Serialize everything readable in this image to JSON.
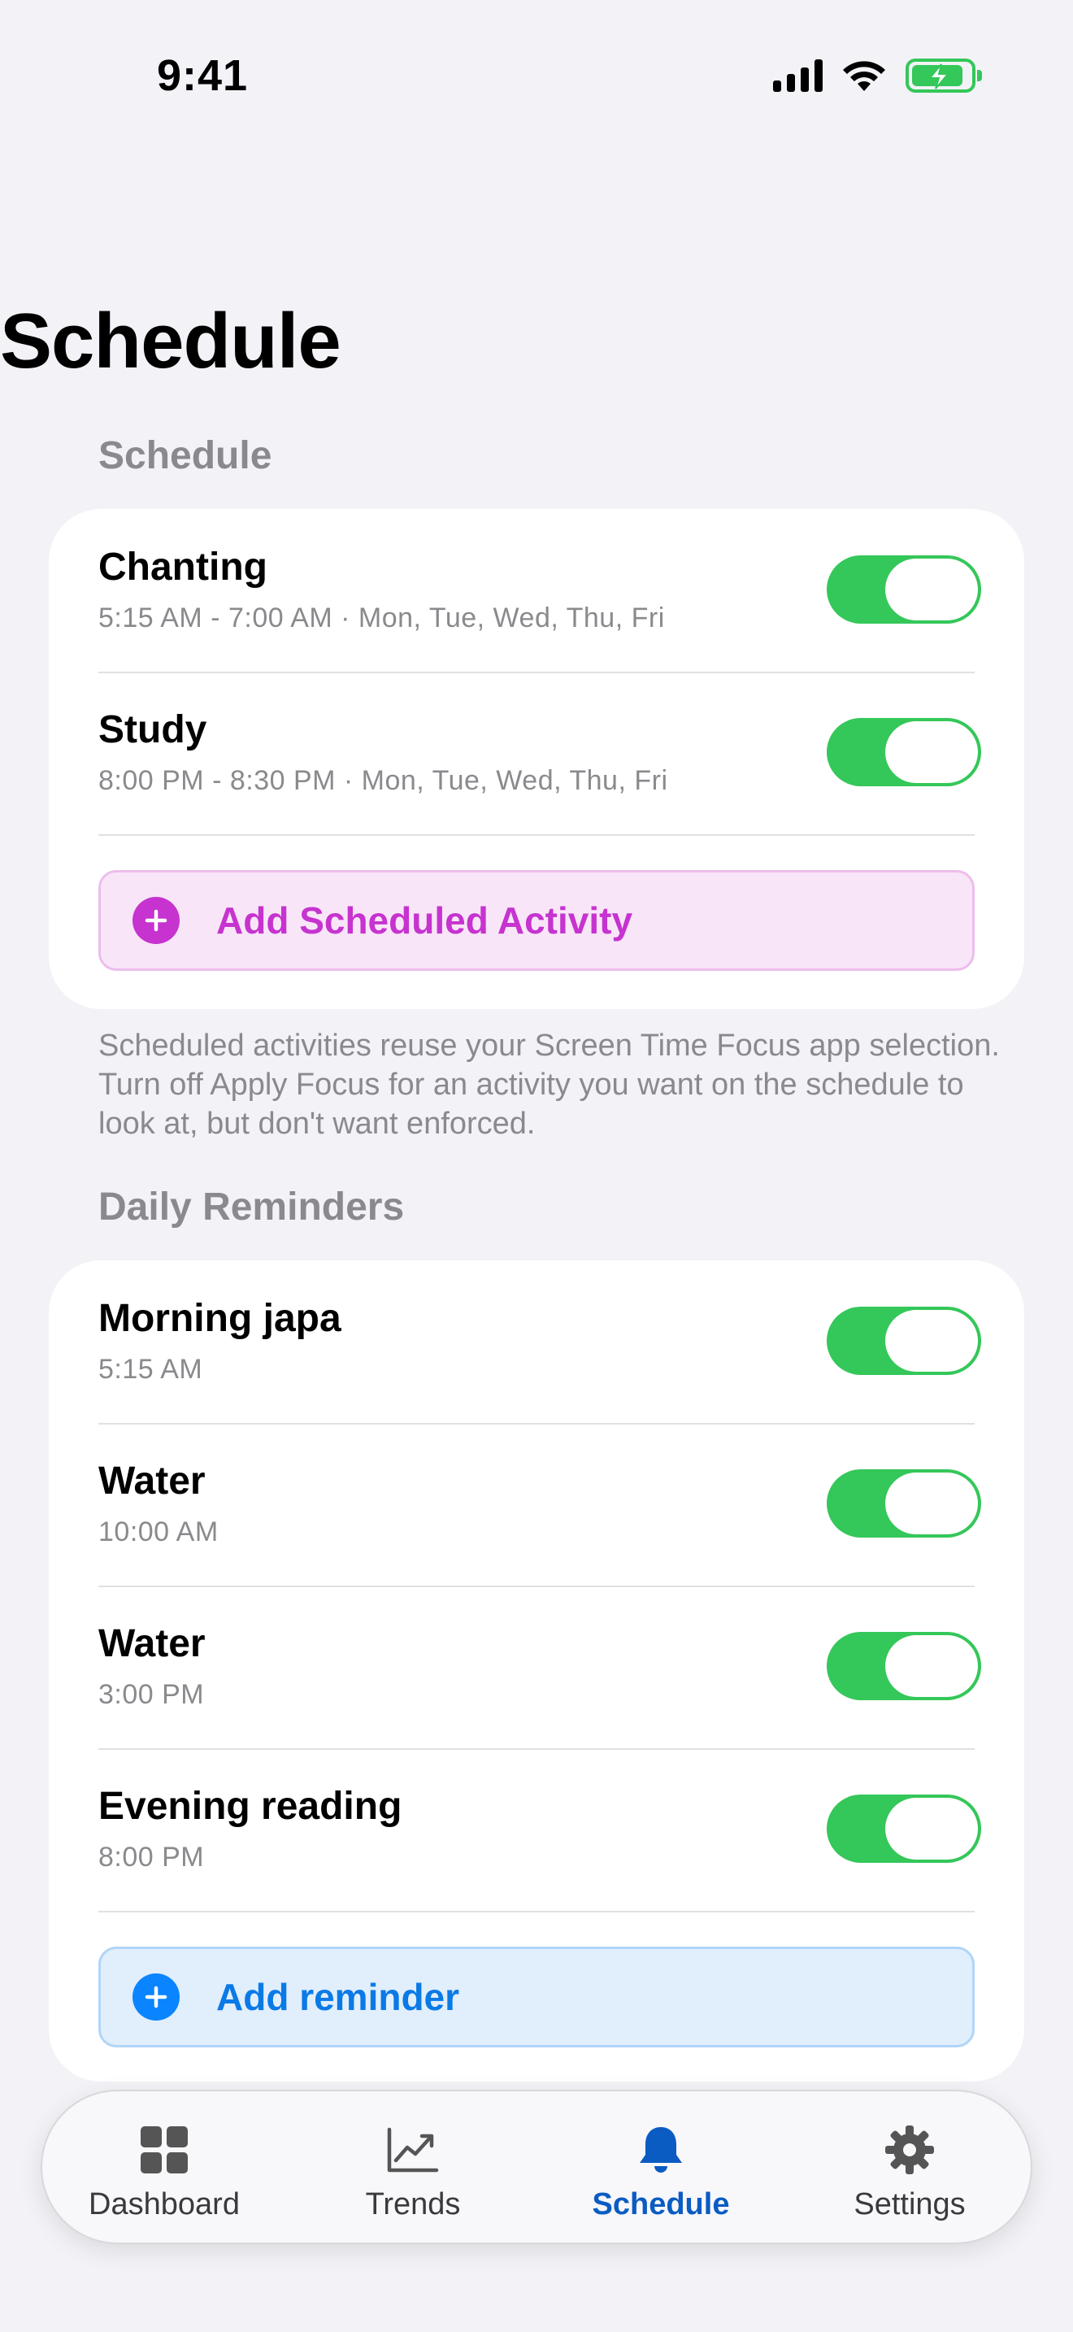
{
  "status_bar": {
    "time": "9:41"
  },
  "page": {
    "title": "Schedule"
  },
  "schedule_section": {
    "header": "Schedule",
    "activities": [
      {
        "title": "Chanting",
        "subtitle": "5:15 AM - 7:00 AM · Mon, Tue, Wed, Thu, Fri",
        "enabled": true
      },
      {
        "title": "Study",
        "subtitle": "8:00 PM - 8:30 PM · Mon, Tue, Wed, Thu, Fri",
        "enabled": true
      }
    ],
    "add_label": "Add Scheduled Activity",
    "footnote": "Scheduled activities reuse your Screen Time Focus app selection. Turn off Apply Focus for an activity you want on the schedule to look at, but don't want enforced."
  },
  "reminders_section": {
    "header": "Daily Reminders",
    "reminders": [
      {
        "title": "Morning japa",
        "time": "5:15 AM",
        "enabled": true
      },
      {
        "title": "Water",
        "time": "10:00 AM",
        "enabled": true
      },
      {
        "title": "Water",
        "time": "3:00 PM",
        "enabled": true
      },
      {
        "title": "Evening reading",
        "time": "8:00 PM",
        "enabled": true
      }
    ],
    "add_label": "Add reminder"
  },
  "tab_bar": {
    "tabs": [
      {
        "label": "Dashboard",
        "icon": "grid-icon",
        "active": false
      },
      {
        "label": "Trends",
        "icon": "chart-icon",
        "active": false
      },
      {
        "label": "Schedule",
        "icon": "bell-icon",
        "active": true
      },
      {
        "label": "Settings",
        "icon": "gear-icon",
        "active": false
      }
    ]
  },
  "colors": {
    "toggle_on": "#34c759",
    "activity_accent": "#c633cf",
    "reminder_accent": "#0a84ff",
    "tab_active": "#0a5cc2"
  }
}
